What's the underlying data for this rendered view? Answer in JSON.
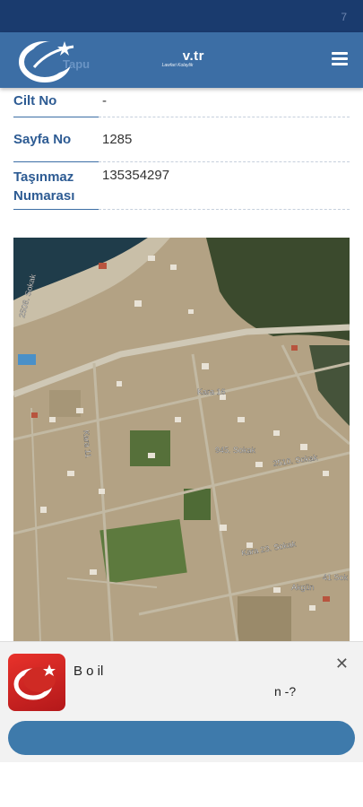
{
  "statusbar": {
    "right_text": "7"
  },
  "header": {
    "ghost_text": "Tapu",
    "brand_main": "v.tr",
    "brand_tagline": "Lawfari Kolaylik",
    "logo_icon": "crescent-star-logo-icon",
    "menu_icon": "hamburger-menu-icon"
  },
  "fields": [
    {
      "label": "Cilt No",
      "value": "-"
    },
    {
      "label": "Sayfa No",
      "value": "1285"
    },
    {
      "label_line1": "Taşınmaz",
      "label_line2": "Numarası",
      "value": "135354297"
    }
  ],
  "map": {
    "street_labels": [
      "945. Sokak",
      "2510. Sokak",
      "Kara 23. Sokak",
      "Kara 16",
      "Kara 11",
      "Akgün",
      "41 Sok",
      "2508. Sokak"
    ]
  },
  "banner": {
    "line1": "B                        o     il",
    "line2": "n -?",
    "close_icon": "close-icon",
    "app_icon": "app-logo-icon",
    "button_label": ""
  },
  "colors": {
    "header_bg": "#3c6ea5",
    "statusbar_bg": "#1a3b6e",
    "label_color": "#2d5b93",
    "button_bg": "#3e7aab"
  }
}
